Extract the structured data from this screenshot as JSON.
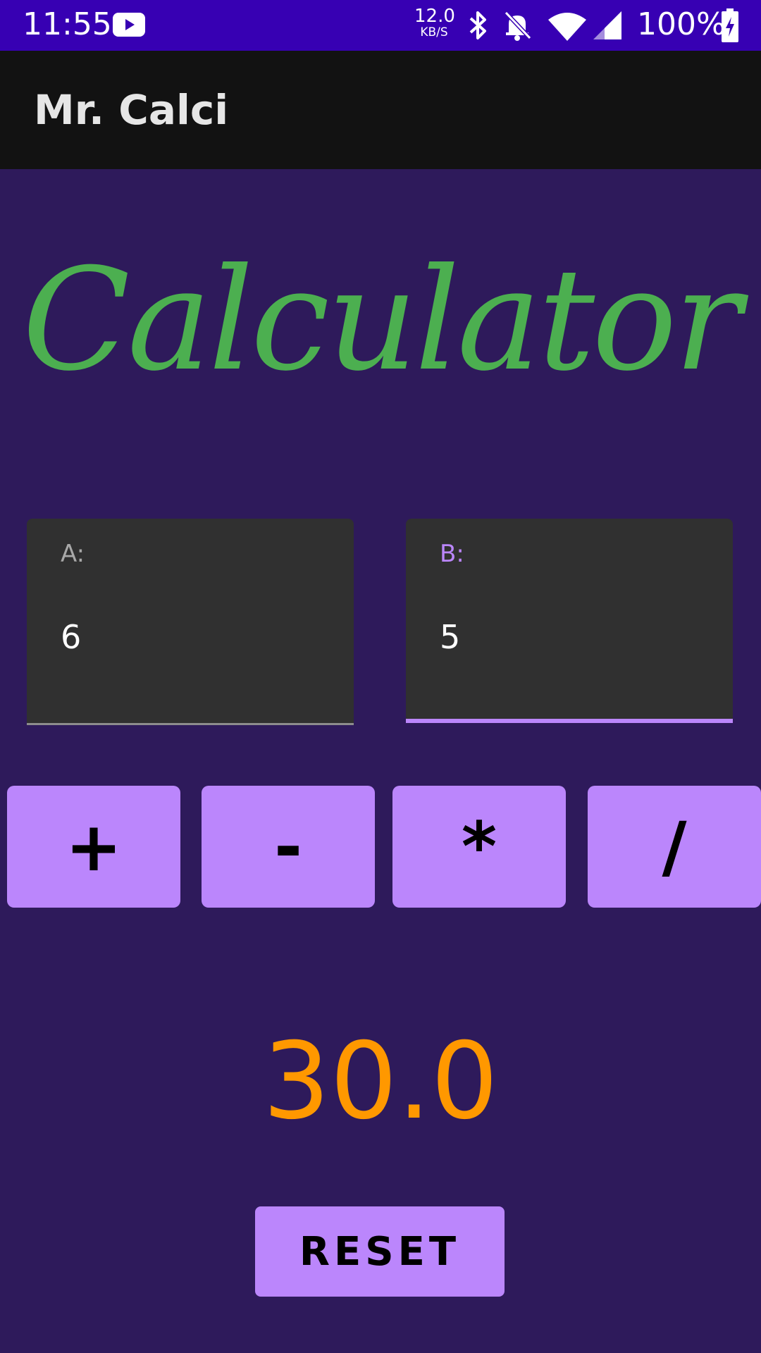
{
  "status_bar": {
    "time": "11:55",
    "net_speed": "12.0",
    "net_speed_unit": "KB/S",
    "battery": "100%",
    "icons": [
      "youtube-icon",
      "bluetooth-icon",
      "mute-icon",
      "wifi-icon",
      "signal-icon",
      "battery-charging-icon"
    ]
  },
  "app_bar": {
    "title": "Mr. Calci"
  },
  "heading": "Calculator",
  "inputs": {
    "a": {
      "label": "A:",
      "value": "6"
    },
    "b": {
      "label": "B:",
      "value": "5"
    }
  },
  "operators": {
    "plus": "+",
    "minus": "-",
    "multiply": "*",
    "divide": "/"
  },
  "result": "30.0",
  "reset_label": "RESET",
  "colors": {
    "status_bar": "#3700b3",
    "app_bar": "#121212",
    "background": "#2e1a5b",
    "heading": "#4caf50",
    "button": "#bb86fc",
    "result": "#ff9800",
    "field": "#303030"
  }
}
